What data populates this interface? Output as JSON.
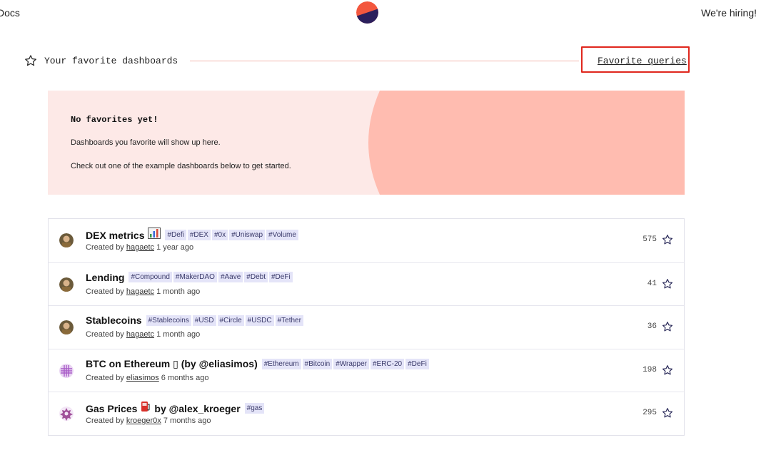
{
  "nav": {
    "docs_label": "Docs",
    "hiring_label": "We're hiring!"
  },
  "favorites": {
    "title": "Your favorite dashboards",
    "queries_link": "Favorite queries",
    "empty_title": "No favorites yet!",
    "empty_line1": "Dashboards you favorite will show up here.",
    "empty_line2": "Check out one of the example dashboards below to get started."
  },
  "colors": {
    "accent": "#f3573e",
    "logo_dark": "#2b1f5c",
    "tag_bg": "#e4e4f8",
    "empty_bg": "#fde9e7",
    "blob": "#ffbcb0",
    "highlight_border": "#e0271d"
  },
  "dashboards": [
    {
      "title": "DEX metrics",
      "emoji": "chart-emoji",
      "tags": [
        "#Defi",
        "#DEX",
        "#0x",
        "#Uniswap",
        "#Volume"
      ],
      "created_prefix": "Created by",
      "author": "hagaetc",
      "age": "1 year ago",
      "stars": "575",
      "avatar": "portrait-avatar"
    },
    {
      "title": "Lending",
      "emoji": "",
      "tags": [
        "#Compound",
        "#MakerDAO",
        "#Aave",
        "#Debt",
        "#DeFi"
      ],
      "created_prefix": "Created by",
      "author": "hagaetc",
      "age": "1 month ago",
      "stars": "41",
      "avatar": "portrait-avatar"
    },
    {
      "title": "Stablecoins",
      "emoji": "",
      "tags": [
        "#Stablecoins",
        "#USD",
        "#Circle",
        "#USDC",
        "#Tether"
      ],
      "created_prefix": "Created by",
      "author": "hagaetc",
      "age": "1 month ago",
      "stars": "36",
      "avatar": "portrait-avatar"
    },
    {
      "title": "BTC on Ethereum ▯ (by @eliasimos)",
      "emoji": "",
      "tags": [
        "#Ethereum",
        "#Bitcoin",
        "#Wrapper",
        "#ERC-20",
        "#DeFi"
      ],
      "created_prefix": "Created by",
      "author": "eliasimos",
      "age": "6 months ago",
      "stars": "198",
      "avatar": "grid-avatar"
    },
    {
      "title": "Gas Prices",
      "emoji": "fuel-pump-emoji",
      "title_suffix": "by @alex_kroeger",
      "tags": [
        "#gas"
      ],
      "created_prefix": "Created by",
      "author": "kroeger0x",
      "age": "7 months ago",
      "stars": "295",
      "avatar": "pattern-avatar"
    }
  ]
}
